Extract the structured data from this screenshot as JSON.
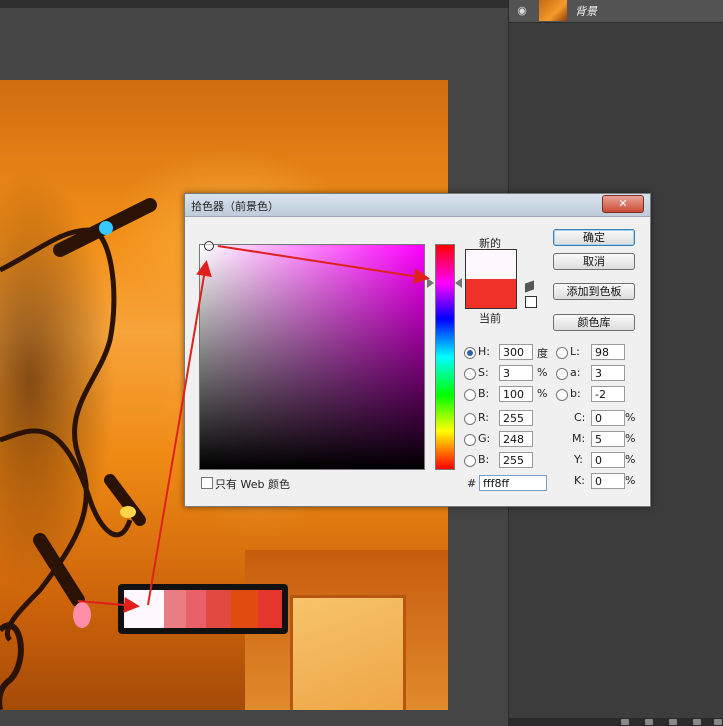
{
  "layers_panel": {
    "layer_name": "背景"
  },
  "swatches": [
    "#fff8ff",
    "#ea7d84",
    "#e96069",
    "#e14a3f",
    "#e04c10",
    "#e5352d"
  ],
  "dialog": {
    "title": "拾色器（前景色）",
    "close_glyph": "✕",
    "new_label": "新的",
    "current_label": "当前",
    "new_color": "#fff8ff",
    "current_color": "#f0312a",
    "ok_label": "确定",
    "cancel_label": "取消",
    "add_swatch_label": "添加到色板",
    "color_library_label": "颜色库",
    "web_only_label": "只有 Web 颜色",
    "hash_label": "#",
    "hex_value": "fff8ff",
    "hsb": [
      {
        "label": "H:",
        "value": "300",
        "unit": "度",
        "selected": true
      },
      {
        "label": "S:",
        "value": "3",
        "unit": "%",
        "selected": false
      },
      {
        "label": "B:",
        "value": "100",
        "unit": "%",
        "selected": false
      }
    ],
    "rgb": [
      {
        "label": "R:",
        "value": "255"
      },
      {
        "label": "G:",
        "value": "248"
      },
      {
        "label": "B:",
        "value": "255"
      }
    ],
    "lab": [
      {
        "label": "L:",
        "value": "98"
      },
      {
        "label": "a:",
        "value": "3"
      },
      {
        "label": "b:",
        "value": "-2"
      }
    ],
    "cmyk": [
      {
        "label": "C:",
        "value": "0",
        "unit": "%"
      },
      {
        "label": "M:",
        "value": "5",
        "unit": "%"
      },
      {
        "label": "Y:",
        "value": "0",
        "unit": "%"
      },
      {
        "label": "K:",
        "value": "0",
        "unit": "%"
      }
    ]
  }
}
